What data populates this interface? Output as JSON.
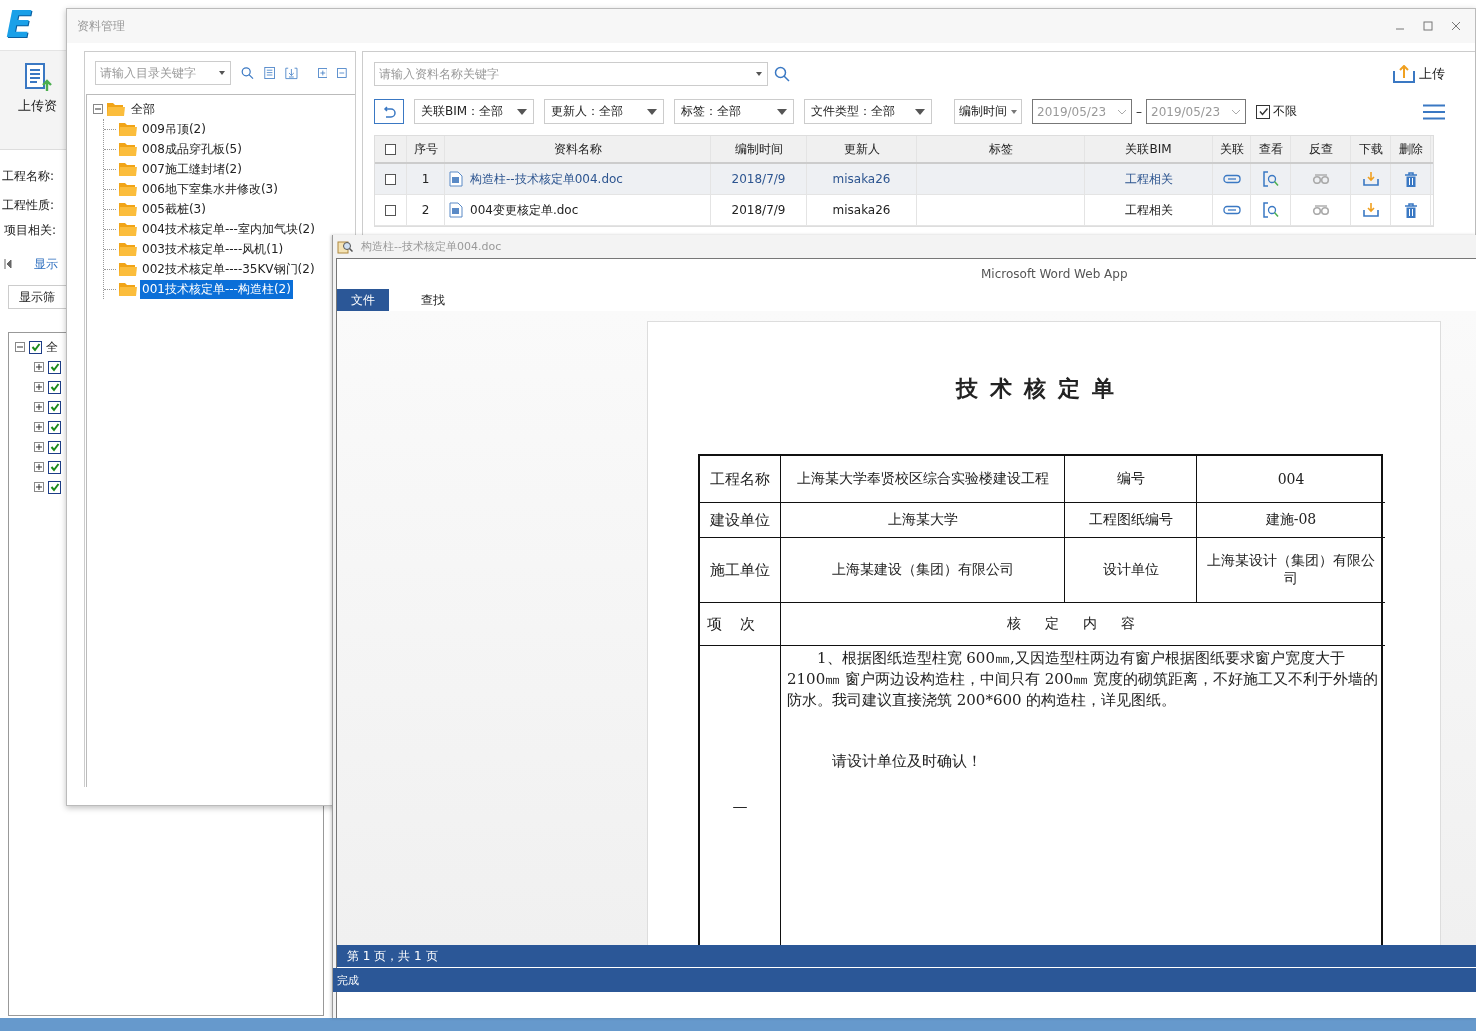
{
  "app": {
    "logo": "E",
    "upload_button": "上传资",
    "fields": [
      "工程名称:",
      "工程性质:",
      "项目相关:"
    ],
    "tab": "显示",
    "filter_button": "显示筛",
    "tree": {
      "label": "全",
      "checked": true,
      "expanded": true,
      "children": [
        {
          "checked": true,
          "expanded": false
        },
        {
          "checked": true,
          "expanded": false
        },
        {
          "checked": true,
          "expanded": false
        },
        {
          "checked": true,
          "expanded": false
        },
        {
          "checked": true,
          "expanded": false
        },
        {
          "checked": true,
          "expanded": false
        },
        {
          "checked": true,
          "expanded": false
        }
      ]
    }
  },
  "dialog": {
    "title": "资料管理",
    "folder_search": {
      "placeholder": "请输入目录关键字"
    },
    "folder_tree": {
      "label": "全部",
      "expanded": true,
      "children": [
        {
          "label": "009吊顶(2)",
          "selected": false
        },
        {
          "label": "008成品穿孔板(5)",
          "selected": false
        },
        {
          "label": "007施工缝封堵(2)",
          "selected": false
        },
        {
          "label": "006地下室集水井修改(3)",
          "selected": false
        },
        {
          "label": "005截桩(3)",
          "selected": false
        },
        {
          "label": "004技术核定单---室内加气块(2)",
          "selected": false
        },
        {
          "label": "003技术核定单----风机(1)",
          "selected": false
        },
        {
          "label": "002技术核定单----35KV钢门(2)",
          "selected": false
        },
        {
          "label": "001技术核定单---构造柱(2)",
          "selected": true
        }
      ]
    },
    "file_search": {
      "placeholder": "请输入资料名称关键字"
    },
    "upload_button": "上传",
    "filters": [
      {
        "label": "关联BIM：全部"
      },
      {
        "label": "更新人：全部"
      },
      {
        "label": "标签：全部"
      },
      {
        "label": "文件类型：全部"
      }
    ],
    "time_filter": "编制时间",
    "date_range": {
      "from": "2019/05/23",
      "separator": "–",
      "to": "2019/05/23",
      "disabled": true
    },
    "unlimited": {
      "label": "不限",
      "checked": true
    },
    "table": {
      "all_checked": false,
      "columns": [
        "序号",
        "资料名称",
        "编制时间",
        "更新人",
        "标签",
        "关联BIM",
        "关联",
        "查看",
        "反查",
        "下载",
        "删除"
      ],
      "rows": [
        {
          "selected": true,
          "checked": false,
          "index": "1",
          "name": "构造柱--技术核定单004.doc",
          "date": "2018/7/9",
          "updater": "misaka26",
          "bim": "工程相关"
        },
        {
          "selected": false,
          "checked": false,
          "index": "2",
          "name": "004变更核定单.doc",
          "date": "2018/7/9",
          "updater": "misaka26",
          "bim": "工程相关"
        }
      ]
    }
  },
  "viewer": {
    "title": "构造柱--技术核定单004.doc",
    "app_name": "Microsoft Word Web App",
    "tabs": [
      {
        "label": "文件",
        "selected": true
      },
      {
        "label": "查找",
        "selected": false
      }
    ],
    "document": {
      "title": "技术核定单",
      "info_rows": [
        [
          "工程名称",
          "上海某大学奉贤校区综合实验楼建设工程",
          "编号",
          "004"
        ],
        [
          "建设单位",
          "上海某大学",
          "工程图纸编号",
          "建施-08"
        ],
        [
          "施工单位",
          "上海某建设（集团）有限公司",
          "设计单位",
          "上海某设计（集团）有限公司"
        ]
      ],
      "section_header": [
        "项次",
        "核定内容"
      ],
      "item": "—",
      "paragraphs": [
        "1、根据图纸造型柱宽 600㎜,又因造型柱两边有窗户根据图纸要求窗户宽度大于 2100㎜ 窗户两边设构造柱，中间只有 200㎜ 宽度的砌筑距离，不好施工又不利于外墙的防水。我司建议直接浇筑 200*600 的构造柱，详见图纸。",
        "请设计单位及时确认！"
      ]
    },
    "page_status": "第 1 页，共 1 页",
    "status": "完成"
  }
}
